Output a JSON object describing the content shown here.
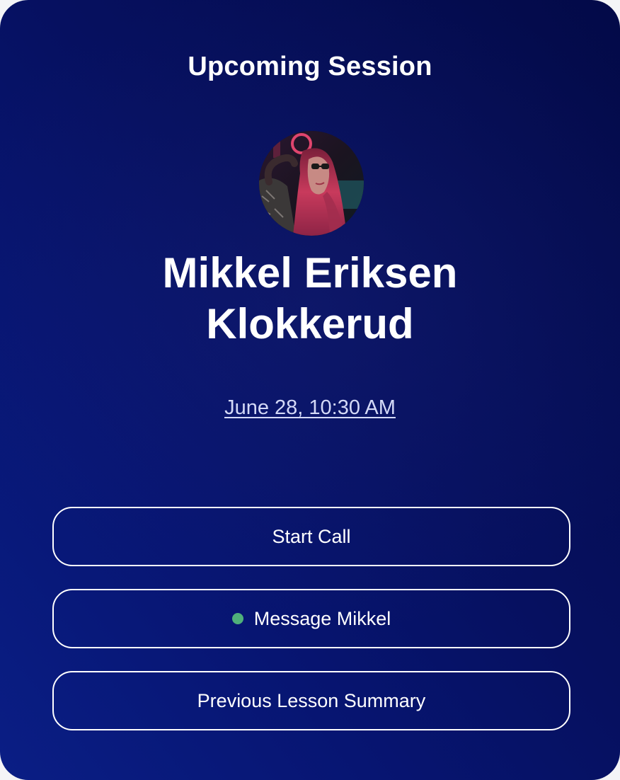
{
  "session": {
    "title": "Upcoming Session",
    "name_line1": "Mikkel Eriksen",
    "name_line2": "Klokkerud",
    "datetime": "June 28, 10:30 AM"
  },
  "actions": {
    "start_call": "Start Call",
    "message": "Message Mikkel",
    "summary": "Previous Lesson Summary"
  },
  "status": {
    "online_color": "#4fb07a"
  },
  "icons": {
    "avatar": "profile-photo",
    "status": "online-status-dot"
  },
  "colors": {
    "background_top": "#030a48",
    "background_bottom": "#0a1e85",
    "text": "#ffffff",
    "link": "#d4d9f7",
    "button_border": "#ffffff"
  }
}
